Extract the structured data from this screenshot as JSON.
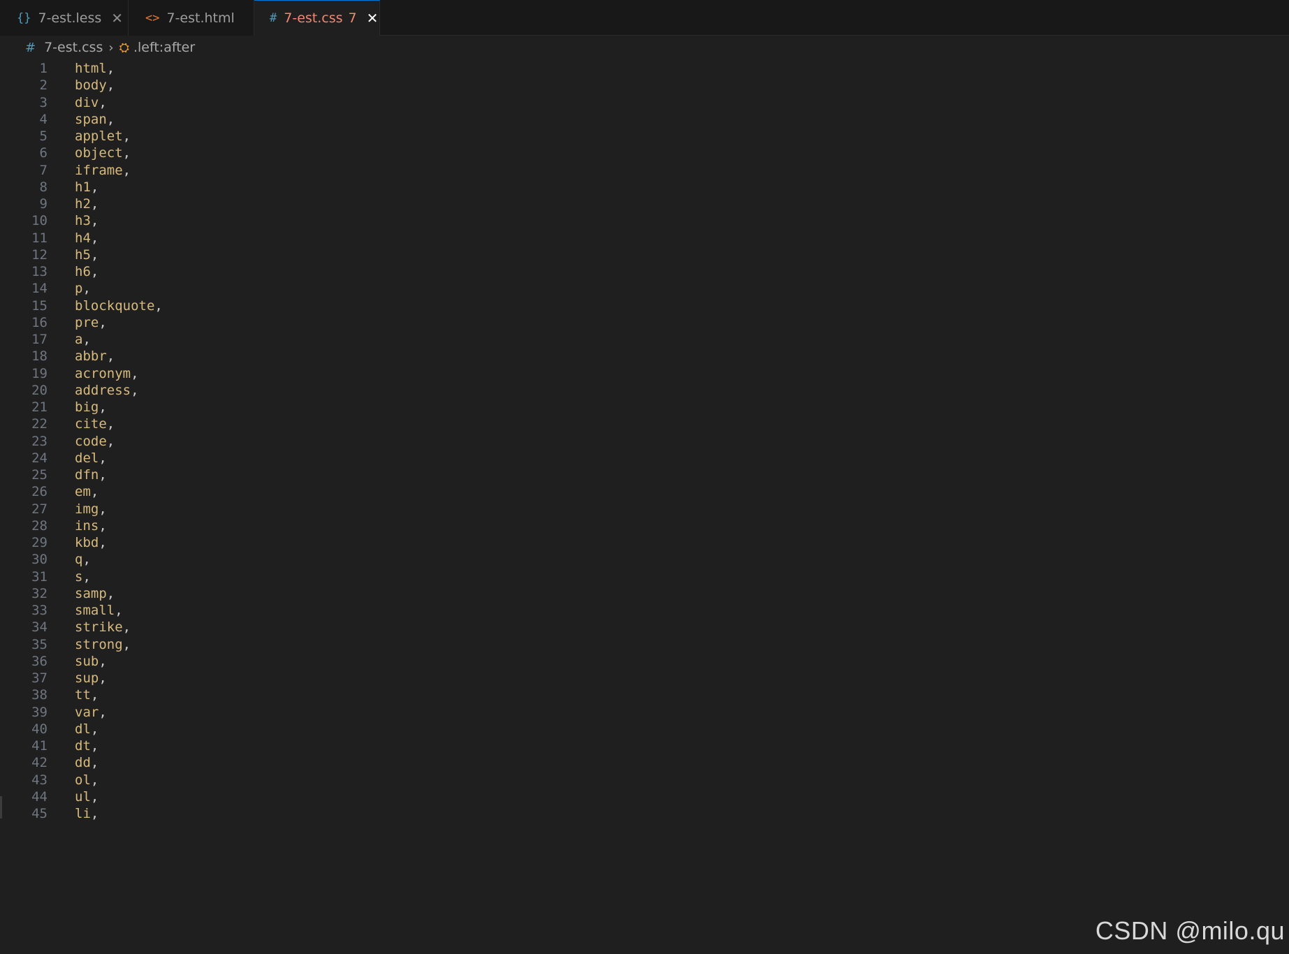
{
  "tabs": [
    {
      "icon": "{}",
      "name": "7-est.less",
      "close": "✕"
    },
    {
      "icon": "<>",
      "name": "7-est.html"
    },
    {
      "icon": "#",
      "name": "7-est.css",
      "problems": "7",
      "close": "✕"
    }
  ],
  "breadcrumb": {
    "file_icon": "#",
    "file": "7-est.css",
    "separator": "›",
    "symbol_icon": "⛭",
    "symbol": ".left:after"
  },
  "lines": [
    {
      "n": "1",
      "sel": "html"
    },
    {
      "n": "2",
      "sel": "body"
    },
    {
      "n": "3",
      "sel": "div"
    },
    {
      "n": "4",
      "sel": "span"
    },
    {
      "n": "5",
      "sel": "applet"
    },
    {
      "n": "6",
      "sel": "object"
    },
    {
      "n": "7",
      "sel": "iframe"
    },
    {
      "n": "8",
      "sel": "h1"
    },
    {
      "n": "9",
      "sel": "h2"
    },
    {
      "n": "10",
      "sel": "h3"
    },
    {
      "n": "11",
      "sel": "h4"
    },
    {
      "n": "12",
      "sel": "h5"
    },
    {
      "n": "13",
      "sel": "h6"
    },
    {
      "n": "14",
      "sel": "p"
    },
    {
      "n": "15",
      "sel": "blockquote"
    },
    {
      "n": "16",
      "sel": "pre"
    },
    {
      "n": "17",
      "sel": "a"
    },
    {
      "n": "18",
      "sel": "abbr"
    },
    {
      "n": "19",
      "sel": "acronym"
    },
    {
      "n": "20",
      "sel": "address"
    },
    {
      "n": "21",
      "sel": "big"
    },
    {
      "n": "22",
      "sel": "cite"
    },
    {
      "n": "23",
      "sel": "code"
    },
    {
      "n": "24",
      "sel": "del"
    },
    {
      "n": "25",
      "sel": "dfn"
    },
    {
      "n": "26",
      "sel": "em"
    },
    {
      "n": "27",
      "sel": "img"
    },
    {
      "n": "28",
      "sel": "ins"
    },
    {
      "n": "29",
      "sel": "kbd"
    },
    {
      "n": "30",
      "sel": "q"
    },
    {
      "n": "31",
      "sel": "s"
    },
    {
      "n": "32",
      "sel": "samp"
    },
    {
      "n": "33",
      "sel": "small"
    },
    {
      "n": "34",
      "sel": "strike"
    },
    {
      "n": "35",
      "sel": "strong"
    },
    {
      "n": "36",
      "sel": "sub"
    },
    {
      "n": "37",
      "sel": "sup"
    },
    {
      "n": "38",
      "sel": "tt"
    },
    {
      "n": "39",
      "sel": "var"
    },
    {
      "n": "40",
      "sel": "dl"
    },
    {
      "n": "41",
      "sel": "dt"
    },
    {
      "n": "42",
      "sel": "dd"
    },
    {
      "n": "43",
      "sel": "ol"
    },
    {
      "n": "44",
      "sel": "ul"
    },
    {
      "n": "45",
      "sel": "li"
    }
  ],
  "punctuation": ",",
  "watermark": "CSDN @milo.qu",
  "colors": {
    "selector": "#d7ba7d",
    "line_number": "#6e7681",
    "active_tab_text": "#f48771"
  }
}
